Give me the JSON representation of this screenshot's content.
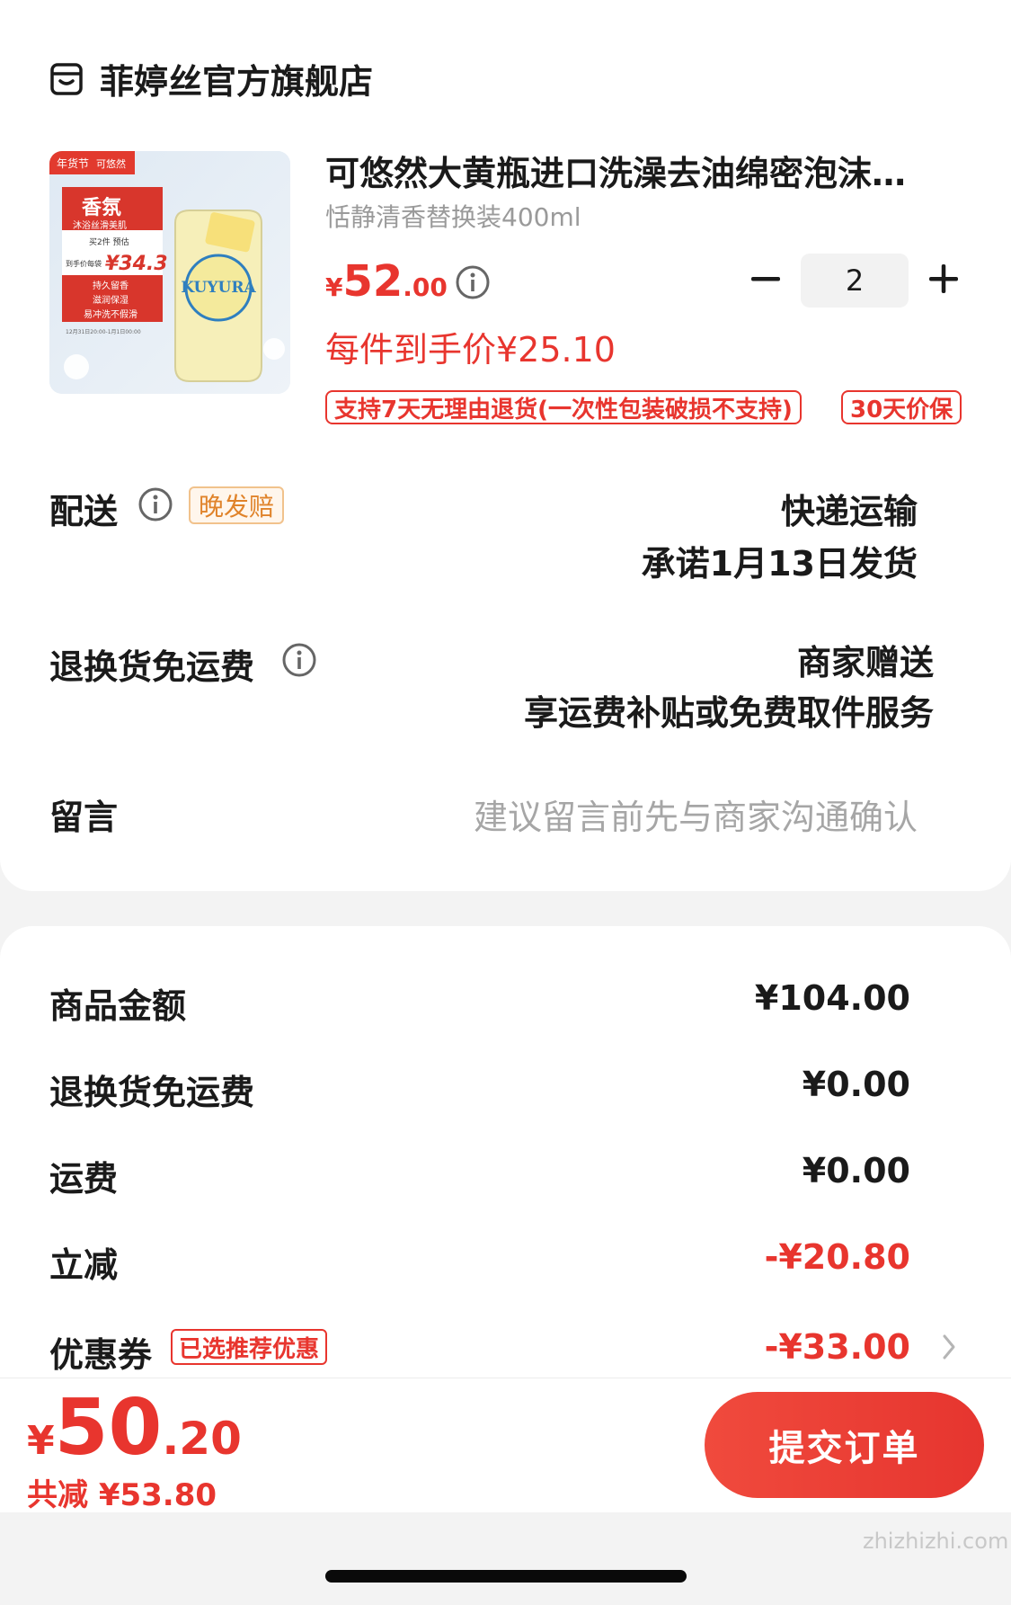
{
  "shop": {
    "name": "菲婷丝官方旗舰店",
    "icon": "store-icon"
  },
  "product": {
    "title": "可悠然大黄瓶进口洗澡去油绵密泡沫…",
    "spec": "恬静清香替换装400ml",
    "price_currency": "¥",
    "price_int": "52",
    "price_dec": ".00",
    "quantity": "2",
    "unit_price": "每件到手价¥25.10",
    "tags": [
      "支持7天无理由退货(一次性包装破损不支持)",
      "30天价保"
    ],
    "image": {
      "promo_top": "年货节",
      "brand": "可悠然",
      "badge_title": "香氛",
      "badge_sub": "沐浴丝滑美肌",
      "deal_line": "买2件 预估",
      "deal_label": "到手价每袋",
      "deal_price": "¥34.3",
      "features": [
        "持久留香",
        "滋润保湿",
        "易冲洗不假滑"
      ],
      "date_note": "12月31日20:00-1月1日00:00",
      "pack_text": "KUYURA"
    }
  },
  "delivery": {
    "label": "配送",
    "badge": "晚发赔",
    "method": "快递运输",
    "promise": "承诺1月13日发货"
  },
  "return_shipping": {
    "label": "退换货免运费",
    "line1": "商家赠送",
    "line2": "享运费补贴或免费取件服务"
  },
  "message": {
    "label": "留言",
    "placeholder": "建议留言前先与商家沟通确认"
  },
  "summary": {
    "goods_label": "商品金额",
    "goods_value": "¥104.00",
    "return_label": "退换货免运费",
    "return_value": "¥0.00",
    "shipping_label": "运费",
    "shipping_value": "¥0.00",
    "discount_label": "立减",
    "discount_value": "-¥20.80",
    "coupon_label": "优惠券",
    "coupon_badge": "已选推荐优惠",
    "coupon_value": "-¥33.00"
  },
  "footer": {
    "total_currency": "¥",
    "total_int": "50",
    "total_dec": ".20",
    "saved": "共减 ¥53.80",
    "submit": "提交订单"
  },
  "watermark": "zhizhizhi.com",
  "colors": {
    "accent": "#e8352e",
    "badge_orange": "#e0832a",
    "muted": "#9a9a9a"
  }
}
